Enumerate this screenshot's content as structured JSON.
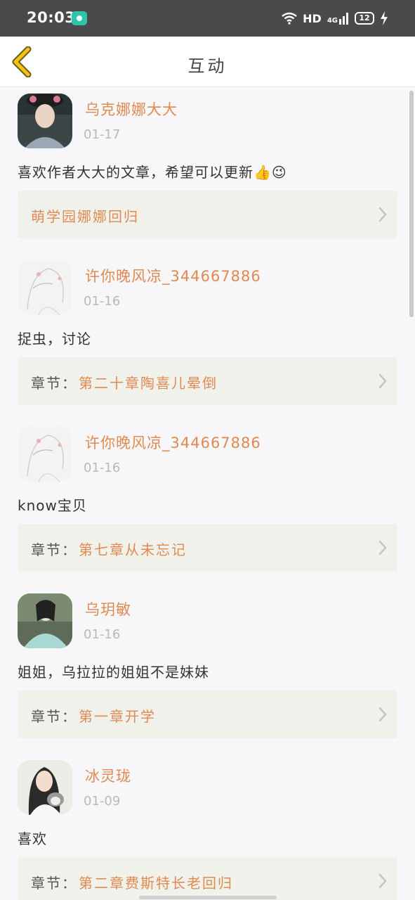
{
  "status_bar": {
    "time": "20:03",
    "network_label": "HD",
    "cellular_label": "4G",
    "battery": "12"
  },
  "header": {
    "title": "互动"
  },
  "comments": [
    {
      "username": "乌克娜娜大大",
      "date": "01-17",
      "text": "喜欢作者大大的文章，希望可以更新👍😉",
      "chapter_prefix": "",
      "chapter_name": "萌学园娜娜回归"
    },
    {
      "username": "许你晚风凉_344667886",
      "date": "01-16",
      "text": "捉虫，讨论",
      "chapter_prefix": "章节：",
      "chapter_name": "第二十章陶喜儿晕倒"
    },
    {
      "username": "许你晚风凉_344667886",
      "date": "01-16",
      "text": "know宝贝",
      "chapter_prefix": "章节：",
      "chapter_name": "第七章从未忘记"
    },
    {
      "username": "乌玥敏",
      "date": "01-16",
      "text": "姐姐，乌拉拉的姐姐不是妹妹",
      "chapter_prefix": "章节：",
      "chapter_name": "第一章开学"
    },
    {
      "username": "冰灵珑",
      "date": "01-09",
      "text": "喜欢",
      "chapter_prefix": "章节：",
      "chapter_name": "第二章费斯特长老回归"
    }
  ],
  "colors": {
    "accent": "#e08a52",
    "chapter_bg": "#f1f1ec",
    "page_bg": "#f7f6f8",
    "back_icon": "#f0c419"
  }
}
